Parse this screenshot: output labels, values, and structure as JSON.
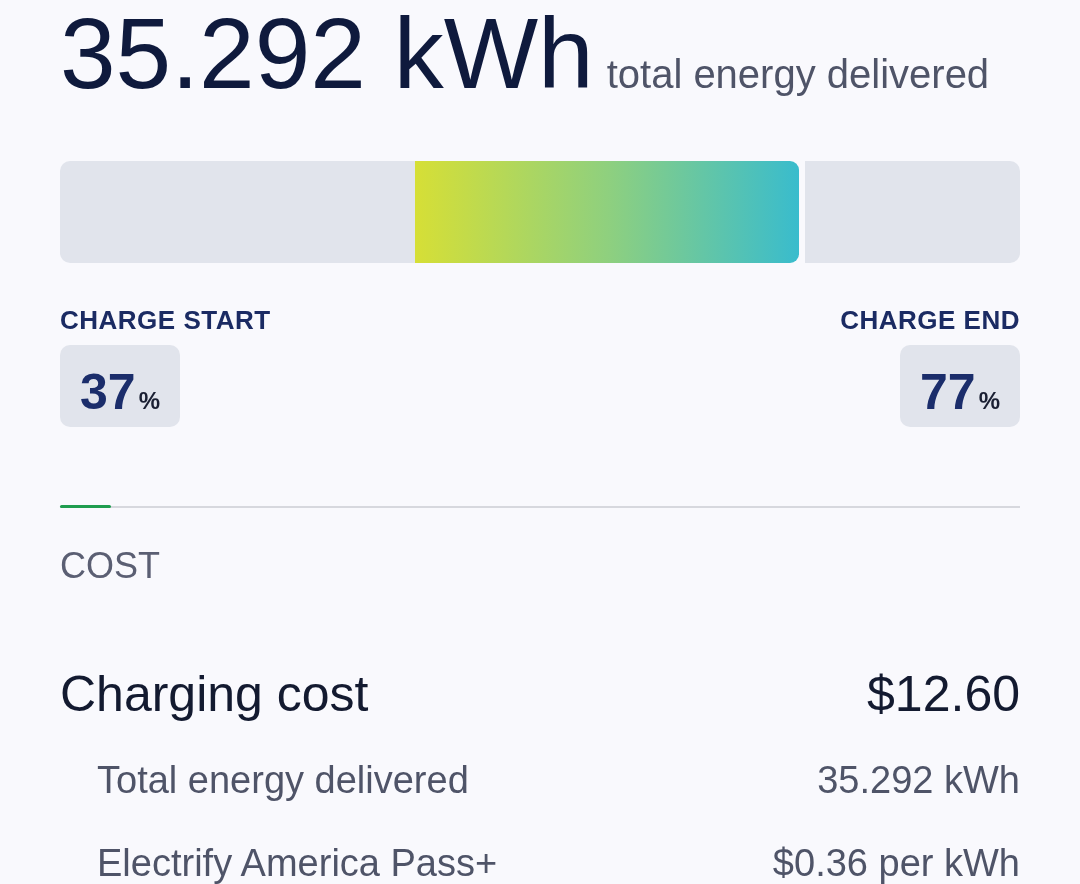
{
  "energy": {
    "value": "35.292 kWh",
    "caption": "total energy delivered"
  },
  "charge_start": {
    "label": "CHARGE START",
    "value": "37",
    "unit": "%",
    "level": 0.37
  },
  "charge_end": {
    "label": "CHARGE END",
    "value": "77",
    "unit": "%",
    "level": 0.77
  },
  "cost": {
    "heading": "COST",
    "total": {
      "label": "Charging cost",
      "amount": "$12.60"
    },
    "details": [
      {
        "label": "Total energy delivered",
        "value": "35.292 kWh"
      },
      {
        "label": "Electrify America Pass+",
        "value": "$0.36 per kWh"
      }
    ]
  }
}
